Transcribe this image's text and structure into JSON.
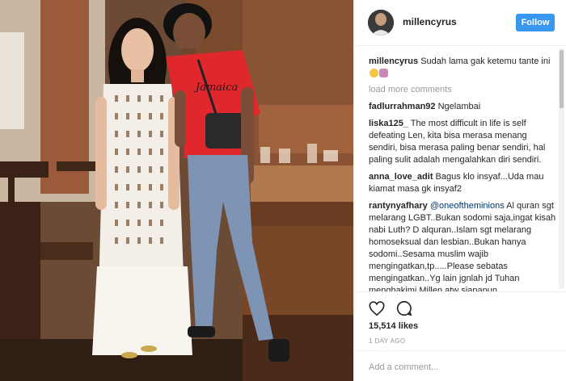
{
  "post": {
    "username": "millencyrus",
    "follow_label": "Follow",
    "caption": {
      "author": "millencyrus",
      "text": "Sudah lama gak ketemu tante ini"
    },
    "load_more_label": "load more comments",
    "comments": [
      {
        "author": "fadlurrahman92",
        "text": "Ngelambai"
      },
      {
        "author": "liska125_",
        "text": "The most difficult in life is self defeating Len, kita bisa merasa menang sendiri, bisa merasa paling benar sendiri, hal paling sulit adalah mengalahkan diri sendiri."
      },
      {
        "author": "anna_love_adit",
        "text": "Bagus klo insyaf...Uda mau kiamat masa gk insyaf2"
      },
      {
        "author": "rantynyafhary",
        "mention": "@oneoftheminions",
        "text": "Al quran sgt melarang LGBT..Bukan sodomi saja,ingat kisah nabi Luth? D alquran..Islam sgt melarang homoseksual dan lesbian..Bukan hanya sodomi..Sesama muslim wajib mengingatkan,tp.....Please sebatas mengingatkan..Yg lain jgnlah jd Tuhan menghakimi Millen atw siapapun"
      }
    ],
    "likes": "15,514 likes",
    "time": "1 DAY AGO",
    "add_comment_placeholder": "Add a comment..."
  },
  "icons": {
    "like": "heart-icon",
    "comment": "speech-bubble-icon",
    "caption_emoji_1": "smiling-face-emoji",
    "caption_emoji_2": "woman-gesturing-emoji"
  },
  "colors": {
    "follow_button": "#3897f0",
    "mention": "#003569",
    "muted": "#999999",
    "text": "#262626"
  }
}
